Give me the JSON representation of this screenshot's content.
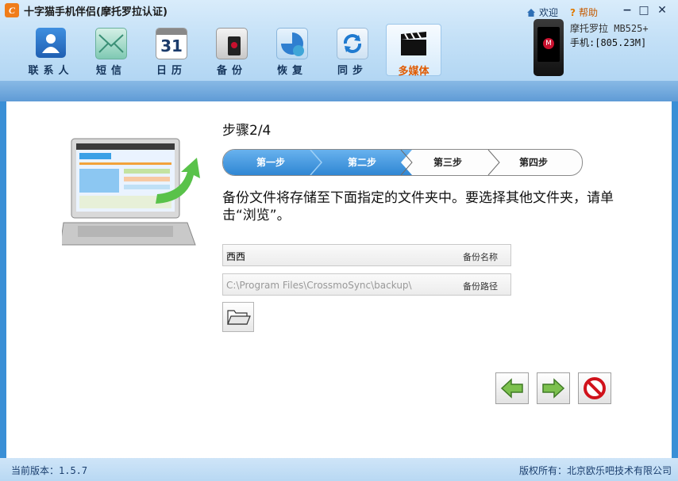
{
  "app": {
    "title": "十字猫手机伴侣(摩托罗拉认证)",
    "welcome": "欢迎",
    "help": "帮助",
    "minimize": "−",
    "maximize": "□",
    "close": "✕"
  },
  "nav": {
    "items": [
      {
        "label": "联系人",
        "icon": "contacts-icon"
      },
      {
        "label": "短信",
        "icon": "sms-envelope-icon"
      },
      {
        "label": "日历",
        "icon": "calendar-icon",
        "icon_text": "31"
      },
      {
        "label": "备份",
        "icon": "backup-icon"
      },
      {
        "label": "恢复",
        "icon": "restore-icon"
      },
      {
        "label": "同步",
        "icon": "sync-icon"
      },
      {
        "label": "多媒体",
        "icon": "multimedia-clapper-icon",
        "active": true
      }
    ]
  },
  "device": {
    "name": "摩托罗拉 MB525+",
    "memory": "手机:[805.23M]",
    "logo_letter": "M"
  },
  "wizard": {
    "step_title": "步骤2/4",
    "steps": [
      "第一步",
      "第二步",
      "第三步",
      "第四步"
    ],
    "current_step": 2,
    "description": "备份文件将存储至下面指定的文件夹中。要选择其他文件夹，请单击“浏览”。",
    "name_value": "西西",
    "name_label": "备份名称",
    "path_value": "C:\\Program Files\\CrossmoSync\\backup\\",
    "path_label": "备份路径"
  },
  "status": {
    "version": "当前版本：1.5.7",
    "copyright": "版权所有：北京欧乐吧技术有限公司"
  },
  "colors": {
    "accent": "#2f8fd8",
    "active_orange": "#e05a00",
    "cancel_red": "#d0121b",
    "arrow_green": "#6cb33f"
  }
}
